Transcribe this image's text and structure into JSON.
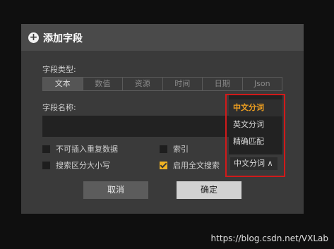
{
  "dialog": {
    "title": "添加字段",
    "icon": "plus-circle-icon",
    "field_type_label": "字段类型:",
    "field_type_tabs": [
      "文本",
      "数值",
      "资源",
      "时间",
      "日期",
      "Json"
    ],
    "field_type_active": "文本",
    "field_name_label": "字段名称:",
    "field_name_value": "",
    "options": {
      "no_duplicates": {
        "label": "不可插入重复数据",
        "checked": false
      },
      "index": {
        "label": "索引",
        "checked": false
      },
      "case_sensitive": {
        "label": "搜索区分大小写",
        "checked": false
      },
      "fulltext": {
        "label": "启用全文搜索",
        "checked": true
      }
    },
    "tokenizer_selected": "中文分词 ∧",
    "tokenizer_options": [
      "中文分词",
      "英文分词",
      "精确匹配"
    ],
    "cancel_label": "取消",
    "ok_label": "确定"
  },
  "colors": {
    "accent": "#f0a020",
    "highlight_border": "#d11a1a"
  },
  "watermark": "https://blog.csdn.net/VXLab"
}
